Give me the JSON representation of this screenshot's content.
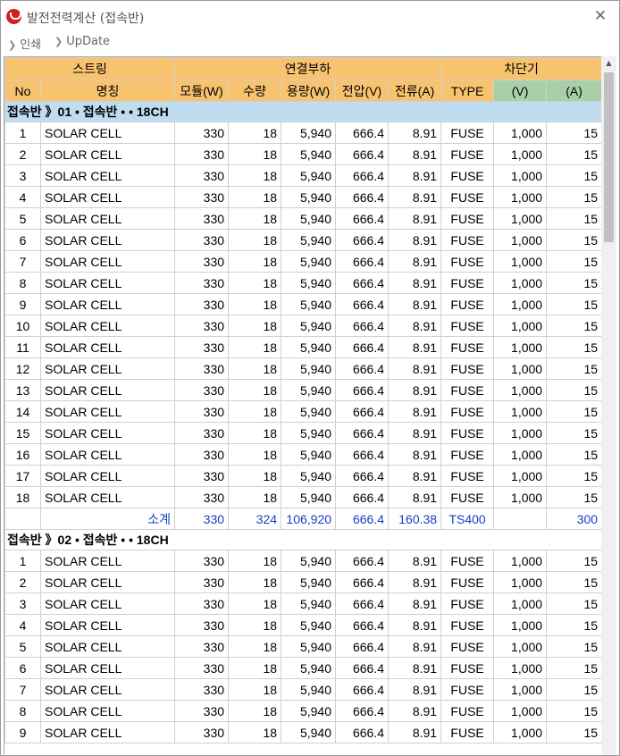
{
  "window": {
    "title": "발전전력계산 (접속반)",
    "close_glyph": "✕"
  },
  "toolbar": {
    "items": [
      {
        "label": "인쇄"
      },
      {
        "label": "UpDate"
      }
    ]
  },
  "table": {
    "header_groups": {
      "string": "스트링",
      "load": "연결부하",
      "breaker": "차단기"
    },
    "columns": [
      "No",
      "명칭",
      "모듈(W)",
      "수량",
      "용량(W)",
      "전압(V)",
      "전류(A)",
      "TYPE",
      "(V)",
      "(A)"
    ],
    "groups": [
      {
        "label": "접속반 》01 • 접속반 • • 18CH",
        "rows": [
          [
            "1",
            "SOLAR CELL",
            "330",
            "18",
            "5,940",
            "666.4",
            "8.91",
            "FUSE",
            "1,000",
            "15"
          ],
          [
            "2",
            "SOLAR CELL",
            "330",
            "18",
            "5,940",
            "666.4",
            "8.91",
            "FUSE",
            "1,000",
            "15"
          ],
          [
            "3",
            "SOLAR CELL",
            "330",
            "18",
            "5,940",
            "666.4",
            "8.91",
            "FUSE",
            "1,000",
            "15"
          ],
          [
            "4",
            "SOLAR CELL",
            "330",
            "18",
            "5,940",
            "666.4",
            "8.91",
            "FUSE",
            "1,000",
            "15"
          ],
          [
            "5",
            "SOLAR CELL",
            "330",
            "18",
            "5,940",
            "666.4",
            "8.91",
            "FUSE",
            "1,000",
            "15"
          ],
          [
            "6",
            "SOLAR CELL",
            "330",
            "18",
            "5,940",
            "666.4",
            "8.91",
            "FUSE",
            "1,000",
            "15"
          ],
          [
            "7",
            "SOLAR CELL",
            "330",
            "18",
            "5,940",
            "666.4",
            "8.91",
            "FUSE",
            "1,000",
            "15"
          ],
          [
            "8",
            "SOLAR CELL",
            "330",
            "18",
            "5,940",
            "666.4",
            "8.91",
            "FUSE",
            "1,000",
            "15"
          ],
          [
            "9",
            "SOLAR CELL",
            "330",
            "18",
            "5,940",
            "666.4",
            "8.91",
            "FUSE",
            "1,000",
            "15"
          ],
          [
            "10",
            "SOLAR CELL",
            "330",
            "18",
            "5,940",
            "666.4",
            "8.91",
            "FUSE",
            "1,000",
            "15"
          ],
          [
            "11",
            "SOLAR CELL",
            "330",
            "18",
            "5,940",
            "666.4",
            "8.91",
            "FUSE",
            "1,000",
            "15"
          ],
          [
            "12",
            "SOLAR CELL",
            "330",
            "18",
            "5,940",
            "666.4",
            "8.91",
            "FUSE",
            "1,000",
            "15"
          ],
          [
            "13",
            "SOLAR CELL",
            "330",
            "18",
            "5,940",
            "666.4",
            "8.91",
            "FUSE",
            "1,000",
            "15"
          ],
          [
            "14",
            "SOLAR CELL",
            "330",
            "18",
            "5,940",
            "666.4",
            "8.91",
            "FUSE",
            "1,000",
            "15"
          ],
          [
            "15",
            "SOLAR CELL",
            "330",
            "18",
            "5,940",
            "666.4",
            "8.91",
            "FUSE",
            "1,000",
            "15"
          ],
          [
            "16",
            "SOLAR CELL",
            "330",
            "18",
            "5,940",
            "666.4",
            "8.91",
            "FUSE",
            "1,000",
            "15"
          ],
          [
            "17",
            "SOLAR CELL",
            "330",
            "18",
            "5,940",
            "666.4",
            "8.91",
            "FUSE",
            "1,000",
            "15"
          ],
          [
            "18",
            "SOLAR CELL",
            "330",
            "18",
            "5,940",
            "666.4",
            "8.91",
            "FUSE",
            "1,000",
            "15"
          ]
        ],
        "subtotal": [
          "",
          "소계",
          "330",
          "324",
          "106,920",
          "666.4",
          "160.38",
          "TS400",
          "",
          "300"
        ]
      },
      {
        "label": "접속반 》02 • 접속반 • • 18CH",
        "rows": [
          [
            "1",
            "SOLAR CELL",
            "330",
            "18",
            "5,940",
            "666.4",
            "8.91",
            "FUSE",
            "1,000",
            "15"
          ],
          [
            "2",
            "SOLAR CELL",
            "330",
            "18",
            "5,940",
            "666.4",
            "8.91",
            "FUSE",
            "1,000",
            "15"
          ],
          [
            "3",
            "SOLAR CELL",
            "330",
            "18",
            "5,940",
            "666.4",
            "8.91",
            "FUSE",
            "1,000",
            "15"
          ],
          [
            "4",
            "SOLAR CELL",
            "330",
            "18",
            "5,940",
            "666.4",
            "8.91",
            "FUSE",
            "1,000",
            "15"
          ],
          [
            "5",
            "SOLAR CELL",
            "330",
            "18",
            "5,940",
            "666.4",
            "8.91",
            "FUSE",
            "1,000",
            "15"
          ],
          [
            "6",
            "SOLAR CELL",
            "330",
            "18",
            "5,940",
            "666.4",
            "8.91",
            "FUSE",
            "1,000",
            "15"
          ],
          [
            "7",
            "SOLAR CELL",
            "330",
            "18",
            "5,940",
            "666.4",
            "8.91",
            "FUSE",
            "1,000",
            "15"
          ],
          [
            "8",
            "SOLAR CELL",
            "330",
            "18",
            "5,940",
            "666.4",
            "8.91",
            "FUSE",
            "1,000",
            "15"
          ],
          [
            "9",
            "SOLAR CELL",
            "330",
            "18",
            "5,940",
            "666.4",
            "8.91",
            "FUSE",
            "1,000",
            "15"
          ]
        ]
      }
    ]
  }
}
